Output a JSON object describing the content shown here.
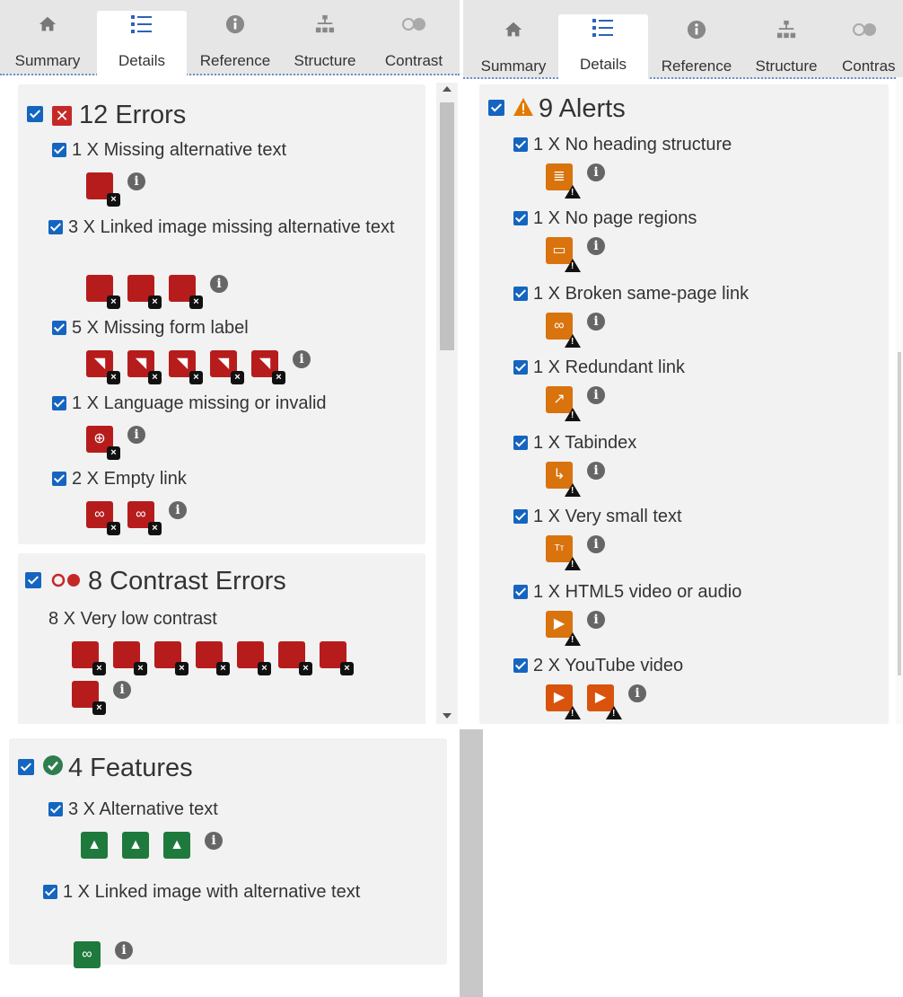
{
  "tabs": [
    {
      "label": "Summary",
      "icon": "home-icon"
    },
    {
      "label": "Details",
      "icon": "list-icon"
    },
    {
      "label": "Reference",
      "icon": "info-icon"
    },
    {
      "label": "Structure",
      "icon": "hierarchy-icon"
    },
    {
      "label": "Contrast",
      "icon": "contrast-icon"
    }
  ],
  "right_tabs": [
    {
      "label": "Summary"
    },
    {
      "label": "Details"
    },
    {
      "label": "Reference"
    },
    {
      "label": "Structure"
    },
    {
      "label": "Contras"
    }
  ],
  "errors": {
    "heading": "12 Errors",
    "items": [
      {
        "label": "1 X Missing alternative text",
        "icon": "missing-alt-icon",
        "count": 1
      },
      {
        "label": "3 X Linked image missing alternative text",
        "icon": "linked-image-icon",
        "count": 3
      },
      {
        "label": "5 X Missing form label",
        "icon": "form-label-icon",
        "count": 5
      },
      {
        "label": "1 X Language missing or invalid",
        "icon": "language-icon",
        "count": 1
      },
      {
        "label": "2 X Empty link",
        "icon": "empty-link-icon",
        "count": 2
      }
    ]
  },
  "contrast": {
    "heading": "8 Contrast Errors",
    "items": [
      {
        "label": "8 X Very low contrast",
        "icon": "contrast-error-icon",
        "count": 8
      }
    ]
  },
  "alerts": {
    "heading": "9 Alerts",
    "items": [
      {
        "label": "1 X No heading structure",
        "icon": "heading-structure-icon",
        "count": 1
      },
      {
        "label": "1 X No page regions",
        "icon": "page-regions-icon",
        "count": 1
      },
      {
        "label": "1 X Broken same-page link",
        "icon": "broken-link-icon",
        "count": 1
      },
      {
        "label": "1 X Redundant link",
        "icon": "redundant-link-icon",
        "count": 1
      },
      {
        "label": "1 X Tabindex",
        "icon": "tabindex-icon",
        "count": 1
      },
      {
        "label": "1 X Very small text",
        "icon": "small-text-icon",
        "count": 1
      },
      {
        "label": "1 X HTML5 video or audio",
        "icon": "html5-media-icon",
        "count": 1
      },
      {
        "label": "2 X YouTube video",
        "icon": "youtube-icon",
        "count": 2
      }
    ]
  },
  "features": {
    "heading": "4 Features",
    "items": [
      {
        "label": "3 X Alternative text",
        "icon": "alt-text-icon",
        "count": 3
      },
      {
        "label": "1 X Linked image with alternative text",
        "icon": "linked-image-alt-icon",
        "count": 1
      }
    ]
  },
  "colors": {
    "error": "#b71c1c",
    "alert": "#d9730d",
    "feature": "#1e7a3c",
    "checkbox": "#1565c0"
  }
}
